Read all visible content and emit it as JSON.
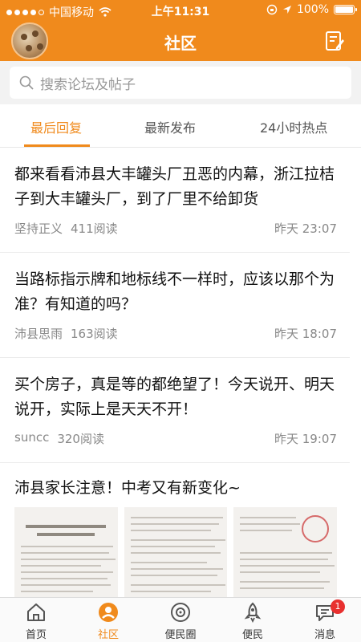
{
  "status_bar": {
    "carrier": "中国移动",
    "time": "上午11:31",
    "battery": "100%"
  },
  "header": {
    "title": "社区"
  },
  "search": {
    "placeholder": "搜索论坛及帖子"
  },
  "tabs": [
    {
      "label": "最后回复",
      "active": true
    },
    {
      "label": "最新发布",
      "active": false
    },
    {
      "label": "24小时热点",
      "active": false
    }
  ],
  "posts": [
    {
      "title": "都来看看沛县大丰罐头厂丑恶的内幕，浙江拉桔子到大丰罐头厂，到了厂里不给卸货",
      "author": "坚持正义",
      "reads": "411阅读",
      "time": "昨天 23:07"
    },
    {
      "title": "当路标指示牌和地标线不一样时，应该以那个为准？有知道的吗？",
      "author": "沛县思雨",
      "reads": "163阅读",
      "time": "昨天 18:07"
    },
    {
      "title": "买个房子，真是等的都绝望了！今天说开、明天说开，实际上是天天不开！",
      "author": "suncc",
      "reads": "320阅读",
      "time": "昨天 19:07"
    },
    {
      "title": "沛县家长注意！中考又有新变化~"
    }
  ],
  "tabbar": [
    {
      "label": "首页",
      "icon": "home-icon",
      "active": false
    },
    {
      "label": "社区",
      "icon": "community-icon",
      "active": true
    },
    {
      "label": "便民圈",
      "icon": "circle-icon",
      "active": false
    },
    {
      "label": "便民",
      "icon": "rocket-icon",
      "active": false
    },
    {
      "label": "消息",
      "icon": "message-icon",
      "active": false,
      "badge": "1"
    }
  ],
  "colors": {
    "accent": "#f08a1c",
    "badge": "#e8302f"
  }
}
